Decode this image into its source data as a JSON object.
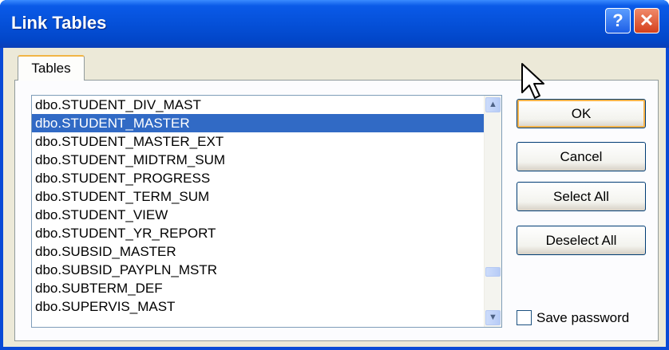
{
  "window": {
    "title": "Link Tables",
    "help_label": "?",
    "close_label": "✕"
  },
  "tabs": [
    {
      "label": "Tables"
    }
  ],
  "list": {
    "items": [
      "dbo.STUDENT_DIV_MAST",
      "dbo.STUDENT_MASTER",
      "dbo.STUDENT_MASTER_EXT",
      "dbo.STUDENT_MIDTRM_SUM",
      "dbo.STUDENT_PROGRESS",
      "dbo.STUDENT_TERM_SUM",
      "dbo.STUDENT_VIEW",
      "dbo.STUDENT_YR_REPORT",
      "dbo.SUBSID_MASTER",
      "dbo.SUBSID_PAYPLN_MSTR",
      "dbo.SUBTERM_DEF",
      "dbo.SUPERVIS_MAST"
    ],
    "selected": "dbo.STUDENT_MASTER"
  },
  "buttons": {
    "ok": "OK",
    "cancel": "Cancel",
    "select_all": "Select All",
    "deselect_all": "Deselect All"
  },
  "save_password": {
    "label": "Save password",
    "checked": false
  },
  "scrollbar": {
    "position": 0.82
  },
  "colors": {
    "title_bar": "#0550d8",
    "selection": "#316ac5",
    "close_button": "#d4401c",
    "default_button_focus": "#f8b34a"
  },
  "icons": {
    "help": "help-icon",
    "close": "close-icon",
    "scroll_up": "chevron-up-icon",
    "scroll_down": "chevron-down-icon",
    "cursor": "mouse-pointer-icon"
  }
}
